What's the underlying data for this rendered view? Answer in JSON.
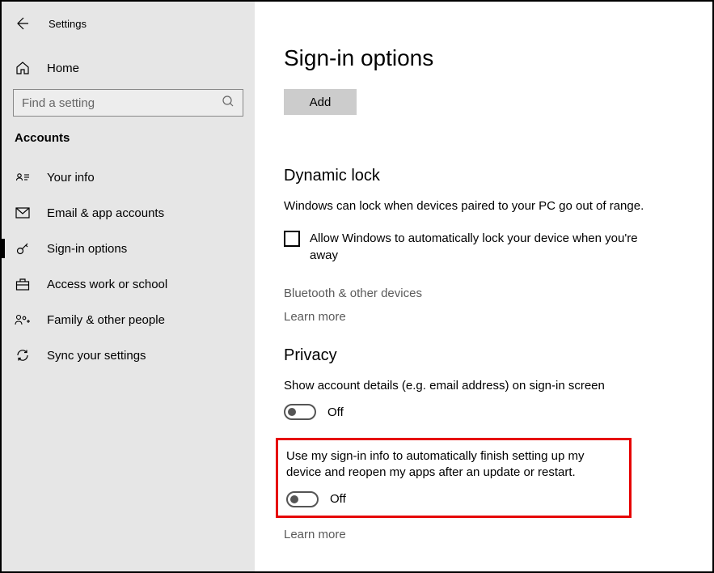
{
  "topbar": {
    "title": "Settings"
  },
  "home": {
    "label": "Home"
  },
  "search": {
    "placeholder": "Find a setting"
  },
  "category": "Accounts",
  "nav": [
    {
      "label": "Your info"
    },
    {
      "label": "Email & app accounts"
    },
    {
      "label": "Sign-in options"
    },
    {
      "label": "Access work or school"
    },
    {
      "label": "Family & other people"
    },
    {
      "label": "Sync your settings"
    }
  ],
  "page": {
    "title": "Sign-in options",
    "add_label": "Add"
  },
  "dynamic_lock": {
    "title": "Dynamic lock",
    "desc": "Windows can lock when devices paired to your PC go out of range.",
    "checkbox_label": "Allow Windows to automatically lock your device when you're away",
    "link1": "Bluetooth & other devices",
    "link2": "Learn more"
  },
  "privacy": {
    "title": "Privacy",
    "setting1_desc": "Show account details (e.g. email address) on sign-in screen",
    "setting1_state": "Off",
    "setting2_desc": "Use my sign-in info to automatically finish setting up my device and reopen my apps after an update or restart.",
    "setting2_state": "Off",
    "link": "Learn more"
  }
}
